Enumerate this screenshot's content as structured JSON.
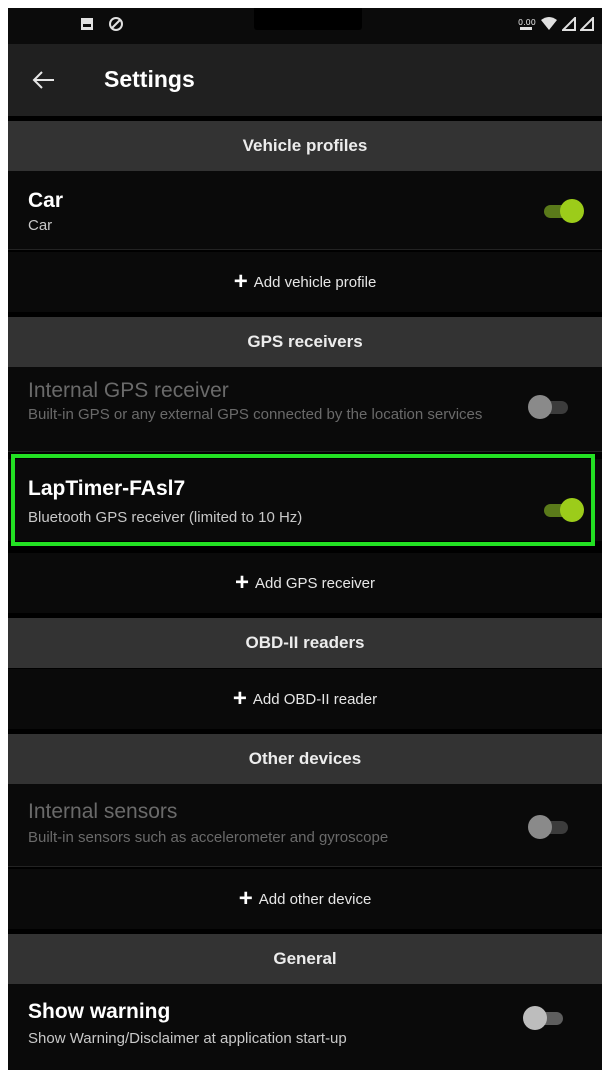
{
  "app_bar": {
    "title": "Settings"
  },
  "sections": {
    "vehicle_profiles": "Vehicle profiles",
    "gps_receivers": "GPS receivers",
    "obd_readers": "OBD-II readers",
    "other_devices": "Other devices",
    "general": "General"
  },
  "rows": {
    "car": {
      "title": "Car",
      "subtitle": "Car",
      "enabled": true
    },
    "internal_gps": {
      "title": "Internal GPS receiver",
      "subtitle": "Built-in GPS or any external GPS connected by the location services",
      "enabled": false
    },
    "laptimer": {
      "title": "LapTimer-FAsl7",
      "subtitle": "Bluetooth GPS receiver (limited to 10 Hz)",
      "enabled": true
    },
    "internal_sensors": {
      "title": "Internal sensors",
      "subtitle": "Built-in sensors such as accelerometer and gyroscope",
      "enabled": false
    },
    "show_warning": {
      "title": "Show warning",
      "subtitle": "Show Warning/Disclaimer at application start-up",
      "enabled": false
    }
  },
  "add_actions": {
    "vehicle": "Add vehicle profile",
    "gps": "Add GPS receiver",
    "obd": "Add OBD-II reader",
    "other": "Add other device"
  },
  "colors": {
    "accent": "#9ccc1a",
    "highlight": "#23e123",
    "section_bg": "#333333",
    "app_bar_bg": "#202020"
  },
  "icons": [
    "back-arrow-icon",
    "plus-icon",
    "image-icon",
    "dnd-icon",
    "wifi-icon",
    "signal-icon",
    "data-icon"
  ]
}
